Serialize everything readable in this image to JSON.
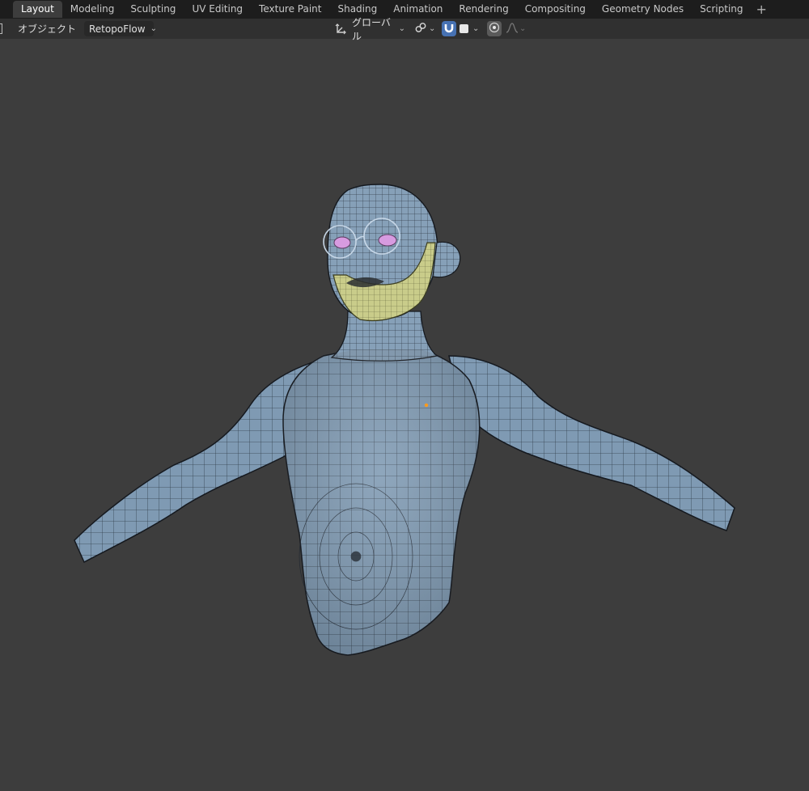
{
  "workspace_tabs": [
    {
      "label": "Layout",
      "active": true
    },
    {
      "label": "Modeling",
      "active": false
    },
    {
      "label": "Sculpting",
      "active": false
    },
    {
      "label": "UV Editing",
      "active": false
    },
    {
      "label": "Texture Paint",
      "active": false
    },
    {
      "label": "Shading",
      "active": false
    },
    {
      "label": "Animation",
      "active": false
    },
    {
      "label": "Rendering",
      "active": false
    },
    {
      "label": "Compositing",
      "active": false
    },
    {
      "label": "Geometry Nodes",
      "active": false
    },
    {
      "label": "Scripting",
      "active": false
    }
  ],
  "add_workspace_label": "+",
  "header": {
    "mode_label": "オブジェクト",
    "addon_dropdown": "RetopoFlow",
    "transform_orientation": "グローバル",
    "snap_icon": "magnet-icon",
    "pivot_icon": "link-pivot-icon",
    "proportional_icon": "proportional-edit-icon",
    "falloff_icon": "falloff-curve-icon"
  },
  "colors": {
    "viewport_bg": "#3d3d3d",
    "mesh_fill": "#7f9ab3",
    "mesh_wire": "#1e2630",
    "beard": "#c9cc8a",
    "eyes": "#d79be0",
    "accent": "#4772b3"
  },
  "viewport": {
    "subject": "retopologized-human-bust",
    "selected_vertex_color": "#ff9a1a"
  }
}
